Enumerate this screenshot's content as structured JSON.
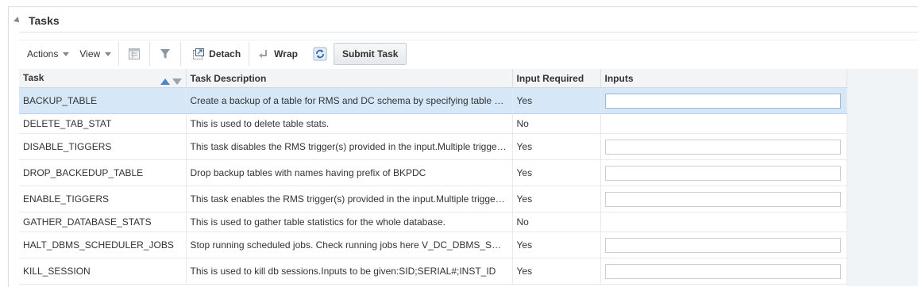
{
  "panel": {
    "title": "Tasks"
  },
  "toolbar": {
    "actions_label": "Actions",
    "view_label": "View",
    "detach_label": "Detach",
    "wrap_label": "Wrap",
    "submit_label": "Submit Task"
  },
  "table": {
    "columns": [
      "Task",
      "Task Description",
      "Input Required",
      "Inputs"
    ],
    "rows": [
      {
        "task": "BACKUP_TABLE",
        "description": "Create a backup of a table for RMS and DC schema by specifying table name and ow",
        "input_required": "Yes",
        "selected": true
      },
      {
        "task": "DELETE_TAB_STAT",
        "description": "This is used to delete table stats.",
        "input_required": "No"
      },
      {
        "task": "DISABLE_TIGGERS",
        "description": "This task disables the RMS trigger(s) provided in the input.Multiple triggers can be",
        "input_required": "Yes"
      },
      {
        "task": "DROP_BACKEDUP_TABLE",
        "description": "Drop backup tables with names having prefix of BKPDC",
        "input_required": "Yes"
      },
      {
        "task": "ENABLE_TIGGERS",
        "description": "This task enables the RMS trigger(s) provided in the input.Multiple triggers can be",
        "input_required": "Yes"
      },
      {
        "task": "GATHER_DATABASE_STATS",
        "description": "This is used to gather table statistics for the whole database.",
        "input_required": "No"
      },
      {
        "task": "HALT_DBMS_SCHEDULER_JOBS",
        "description": "Stop running scheduled jobs. Check running jobs here V_DC_DBMS_SCHEDULER_JOBS",
        "input_required": "Yes"
      },
      {
        "task": "KILL_SESSION",
        "description": "This is used to kill db sessions.Inputs to be given:SID;SERIAL#;INST_ID",
        "input_required": "Yes"
      }
    ]
  },
  "colors": {
    "selected_row": "#d6e8f8",
    "sort_active": "#4d86c9",
    "header_bg": "#f2f4f6"
  },
  "icons": [
    "collapse-triangle-icon",
    "dropdown-arrow-icon",
    "freeze-icon",
    "filter-icon",
    "detach-icon",
    "wrap-icon",
    "refresh-icon",
    "sort-ascending-icon",
    "sort-descending-icon"
  ]
}
